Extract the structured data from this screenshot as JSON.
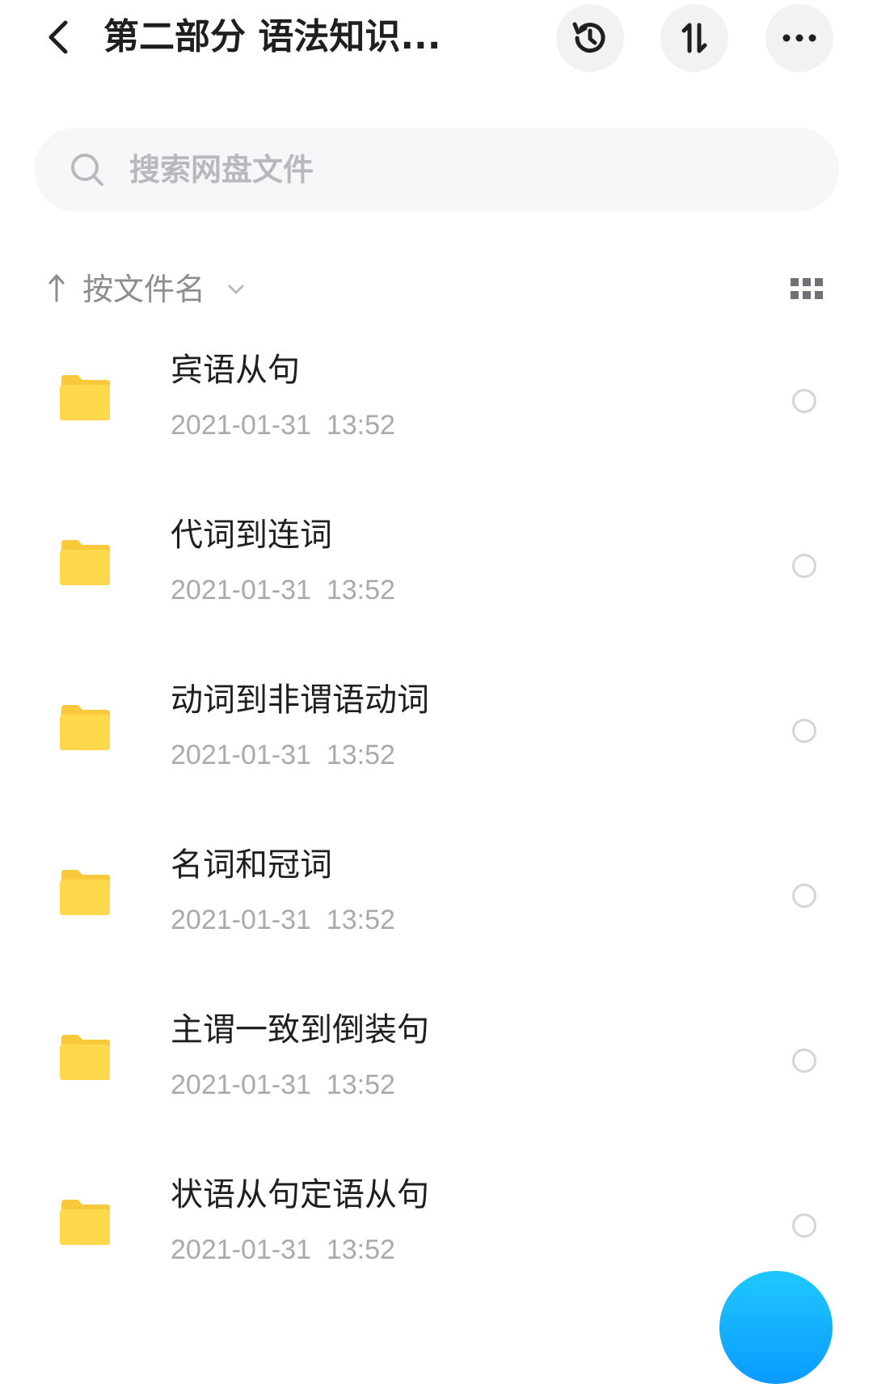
{
  "header": {
    "title": "第二部分 语法知识...",
    "back_icon": "chevron-left-icon",
    "actions": [
      {
        "name": "history",
        "icon": "history-clock-icon"
      },
      {
        "name": "transfer",
        "icon": "sort-transfer-icon"
      },
      {
        "name": "more",
        "icon": "more-dots-icon"
      }
    ]
  },
  "search": {
    "placeholder": "搜索网盘文件",
    "icon": "search-icon"
  },
  "sort": {
    "label": "按文件名",
    "direction_icon": "arrow-up-icon",
    "dropdown_icon": "chevron-down-icon",
    "view_toggle_icon": "grid-view-icon"
  },
  "files": [
    {
      "name": "宾语从句",
      "time": "2021-01-31  13:52",
      "type": "folder"
    },
    {
      "name": "代词到连词",
      "time": "2021-01-31  13:52",
      "type": "folder"
    },
    {
      "name": "动词到非谓语动词",
      "time": "2021-01-31  13:52",
      "type": "folder"
    },
    {
      "name": "名词和冠词",
      "time": "2021-01-31  13:52",
      "type": "folder"
    },
    {
      "name": "主谓一致到倒装句",
      "time": "2021-01-31  13:52",
      "type": "folder"
    },
    {
      "name": "状语从句定语从句",
      "time": "2021-01-31  13:52",
      "type": "folder"
    }
  ],
  "colors": {
    "folder": "#ffd84d",
    "folder_tab": "#f8c93a",
    "fab": "#12b4ff",
    "muted_text": "#a9aaae"
  }
}
